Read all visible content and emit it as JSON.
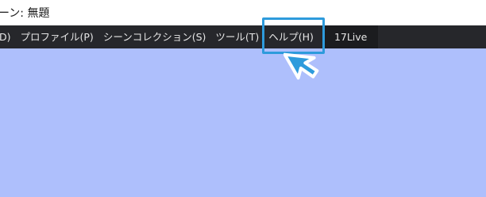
{
  "window": {
    "title": "ーン: 無題"
  },
  "menu": {
    "items": [
      {
        "label": "D)"
      },
      {
        "label": "プロファイル(P)"
      },
      {
        "label": "シーンコレクション(S)"
      },
      {
        "label": "ツール(T)"
      },
      {
        "label": "ヘルプ(H)"
      },
      {
        "label": "17Live"
      }
    ]
  },
  "colors": {
    "highlight": "#2e9bdc",
    "canvas": "#aebffc",
    "menubar": "#26272b"
  },
  "cursor_icon": "pointer-arrow-icon"
}
